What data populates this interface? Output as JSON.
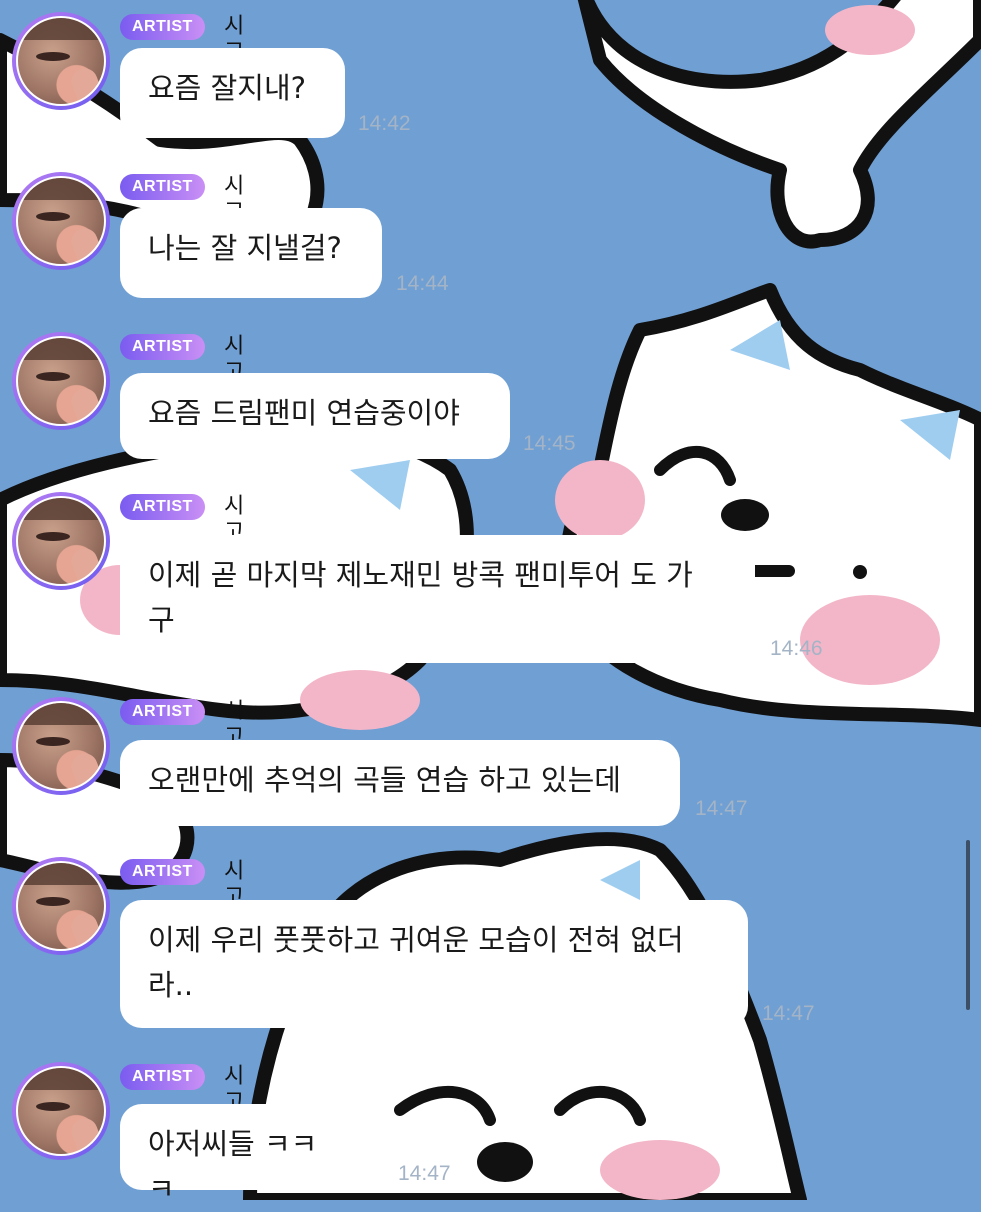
{
  "messages": [
    {
      "badge": "ARTIST",
      "name": "시고르자브",
      "text": "요즘 잘지내?",
      "time": "14:42"
    },
    {
      "badge": "ARTIST",
      "name": "시고르자브",
      "text": "나는 잘 지낼걸?",
      "time": "14:44"
    },
    {
      "badge": "ARTIST",
      "name": "시고르자브",
      "text": "요즘 드림팬미 연습중이야",
      "time": "14:45"
    },
    {
      "badge": "ARTIST",
      "name": "시고르자브",
      "text": "이제 곧 마지막 제노재민 방콕 팬미투어 도 가\n구",
      "time": "14:46"
    },
    {
      "badge": "ARTIST",
      "name": "시고르자브",
      "text": "오랜만에 추억의 곡들 연습 하고 있는데",
      "time": "14:47"
    },
    {
      "badge": "ARTIST",
      "name": "시고르자브",
      "text": "이제 우리 풋풋하고 귀여운 모습이 전혀 없더\n라..",
      "time": "14:47"
    },
    {
      "badge": "ARTIST",
      "name": "시고르자브",
      "text": "아저씨들 ㅋㅋㅋ",
      "time": "14:47"
    }
  ],
  "theme": {
    "background": "#6f9fd3",
    "badge_gradient": [
      "#7a5cf0",
      "#c98ff5"
    ],
    "bubble": "#ffffff",
    "time_color": "#a4b4c6"
  },
  "icons": {
    "avatar": "profile-photo",
    "wallpaper": "white-cat-pattern"
  }
}
